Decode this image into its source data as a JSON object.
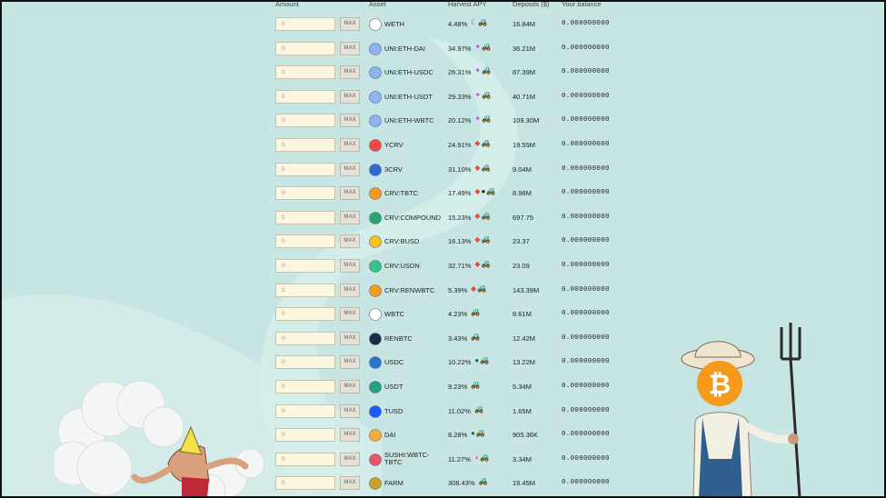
{
  "header": {
    "amount": "Amount",
    "asset": "Asset",
    "apy": "Harvest APY",
    "deposits": "Deposits ($)",
    "balance": "Your balance"
  },
  "amount_placeholder": "0",
  "max_label": "MAX",
  "rows": [
    {
      "asset": "WETH",
      "apy": "4.48%",
      "deposits": "16.84M",
      "balance": "0.000000000",
      "icon": "ethereum-icon",
      "apy_icons": [
        "crescent-icon",
        "tractor-icon"
      ]
    },
    {
      "asset": "UNI:ETH-DAI",
      "apy": "34.97%",
      "deposits": "36.21M",
      "balance": "0.000000000",
      "icon": "uniswap-lp-icon",
      "apy_icons": [
        "unicorn-icon",
        "tractor-icon"
      ]
    },
    {
      "asset": "UNI:ETH-USDC",
      "apy": "26.31%",
      "deposits": "87.39M",
      "balance": "0.000000000",
      "icon": "uniswap-lp-icon",
      "apy_icons": [
        "unicorn-icon",
        "tractor-icon"
      ]
    },
    {
      "asset": "UNI:ETH-USDT",
      "apy": "29.33%",
      "deposits": "40.71M",
      "balance": "0.000000000",
      "icon": "uniswap-lp-icon",
      "apy_icons": [
        "unicorn-icon",
        "tractor-icon"
      ]
    },
    {
      "asset": "UNI:ETH-WBTC",
      "apy": "20.12%",
      "deposits": "109.30M",
      "balance": "0.000000000",
      "icon": "uniswap-lp-icon",
      "apy_icons": [
        "unicorn-icon",
        "tractor-icon"
      ]
    },
    {
      "asset": "YCRV",
      "apy": "24.91%",
      "deposits": "19.55M",
      "balance": "0.000000000",
      "icon": "curve-icon",
      "apy_icons": [
        "curve-icon",
        "tractor-icon"
      ]
    },
    {
      "asset": "3CRV",
      "apy": "31.10%",
      "deposits": "9.04M",
      "balance": "0.000000000",
      "icon": "curve-3pool-icon",
      "apy_icons": [
        "curve-icon",
        "tractor-icon"
      ]
    },
    {
      "asset": "CRV:TBTC",
      "apy": "17.49%",
      "deposits": "8.98M",
      "balance": "0.000000000",
      "icon": "curve-tbtc-icon",
      "apy_icons": [
        "curve-icon",
        "keep-icon",
        "tractor-icon"
      ]
    },
    {
      "asset": "CRV:COMPOUND",
      "apy": "15.23%",
      "deposits": "697.75",
      "balance": "0.000000000",
      "icon": "curve-compound-icon",
      "apy_icons": [
        "curve-icon",
        "tractor-icon"
      ]
    },
    {
      "asset": "CRV:BUSD",
      "apy": "16.13%",
      "deposits": "23.37",
      "balance": "0.000000000",
      "icon": "curve-busd-icon",
      "apy_icons": [
        "curve-icon",
        "tractor-icon"
      ]
    },
    {
      "asset": "CRV:USDN",
      "apy": "32.71%",
      "deposits": "23.09",
      "balance": "0.000000000",
      "icon": "curve-usdn-icon",
      "apy_icons": [
        "curve-icon",
        "tractor-icon"
      ]
    },
    {
      "asset": "CRV:RENWBTC",
      "apy": "5.39%",
      "deposits": "143.39M",
      "balance": "0.000000000",
      "icon": "bitcoin-icon",
      "apy_icons": [
        "curve-icon",
        "tractor-icon"
      ]
    },
    {
      "asset": "WBTC",
      "apy": "4.23%",
      "deposits": "8.61M",
      "balance": "0.000000000",
      "icon": "wbtc-icon",
      "apy_icons": [
        "tractor-icon"
      ]
    },
    {
      "asset": "RENBTC",
      "apy": "3.43%",
      "deposits": "12.42M",
      "balance": "0.000000000",
      "icon": "renbtc-icon",
      "apy_icons": [
        "tractor-icon"
      ]
    },
    {
      "asset": "USDC",
      "apy": "10.22%",
      "deposits": "13.22M",
      "balance": "0.000000000",
      "icon": "usdc-icon",
      "apy_icons": [
        "compound-icon",
        "tractor-icon"
      ]
    },
    {
      "asset": "USDT",
      "apy": "9.23%",
      "deposits": "5.34M",
      "balance": "0.000000000",
      "icon": "tether-icon",
      "apy_icons": [
        "tractor-icon"
      ]
    },
    {
      "asset": "TUSD",
      "apy": "11.02%",
      "deposits": "1.65M",
      "balance": "0.000000000",
      "icon": "tusd-icon",
      "apy_icons": [
        "tractor-icon"
      ]
    },
    {
      "asset": "DAI",
      "apy": "8.28%",
      "deposits": "905.36K",
      "balance": "0.000000000",
      "icon": "dai-icon",
      "apy_icons": [
        "compound-icon",
        "tractor-icon"
      ]
    },
    {
      "asset": "SUSHI:WBTC-TBTC",
      "apy": "11.27%",
      "deposits": "3.34M",
      "balance": "0.000000000",
      "icon": "sushi-icon",
      "apy_icons": [
        "sushi-icon",
        "tractor-icon"
      ]
    },
    {
      "asset": "FARM",
      "apy": "308.43%",
      "deposits": "19.45M",
      "balance": "0.000000000",
      "icon": "farm-tractor-icon",
      "apy_icons": [
        "tractor-icon"
      ]
    }
  ],
  "colors": {
    "background": "#c6e5e3",
    "input_bg": "#fbf6df"
  }
}
